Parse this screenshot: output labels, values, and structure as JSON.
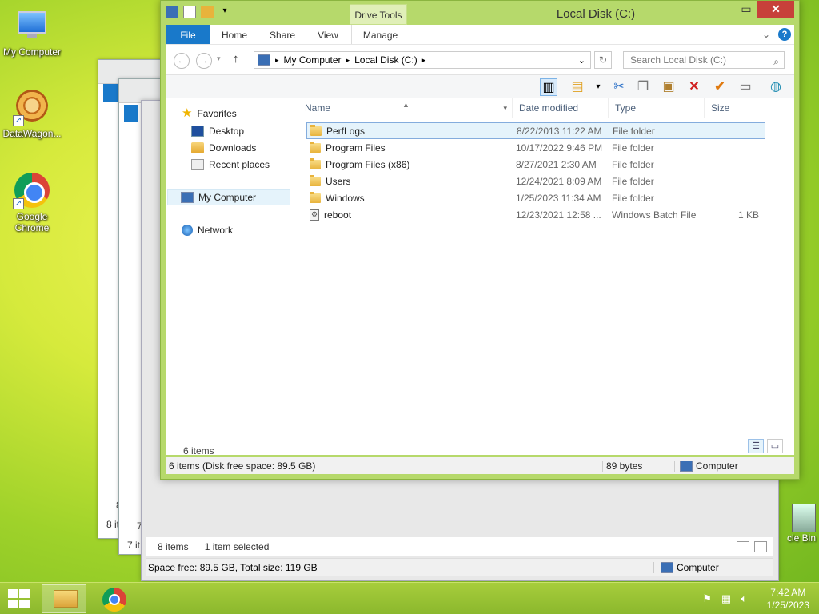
{
  "desktop": {
    "icons": [
      {
        "label": "My Computer"
      },
      {
        "label": "DataWagon..."
      },
      {
        "label": "Google Chrome"
      }
    ],
    "recycle_bin_partial": "cle Bin"
  },
  "back_windows": {
    "win1_status_partial": "8 it",
    "win1_digit": "8",
    "win2_status_partial": "7 it",
    "win2_digit": "7"
  },
  "back_explorer": {
    "items_count": "8 items",
    "selected": "1 item selected",
    "space": "Space free: 89.5 GB, Total size: 119 GB",
    "computer": "Computer"
  },
  "window": {
    "title": "Local Disk (C:)",
    "context_tab": "Drive Tools",
    "tabs": [
      "File",
      "Home",
      "Share",
      "View",
      "Manage"
    ],
    "breadcrumb": [
      "My Computer",
      "Local Disk (C:)"
    ],
    "search_placeholder": "Search Local Disk (C:)",
    "columns": [
      "Name",
      "Date modified",
      "Type",
      "Size"
    ],
    "nav": {
      "favorites": "Favorites",
      "desktop": "Desktop",
      "downloads": "Downloads",
      "recent": "Recent places",
      "my_computer": "My Computer",
      "network": "Network"
    },
    "files": [
      {
        "name": "PerfLogs",
        "date": "8/22/2013 11:22 AM",
        "type": "File folder",
        "size": ""
      },
      {
        "name": "Program Files",
        "date": "10/17/2022 9:46 PM",
        "type": "File folder",
        "size": ""
      },
      {
        "name": "Program Files (x86)",
        "date": "8/27/2021 2:30 AM",
        "type": "File folder",
        "size": ""
      },
      {
        "name": "Users",
        "date": "12/24/2021 8:09 AM",
        "type": "File folder",
        "size": ""
      },
      {
        "name": "Windows",
        "date": "1/25/2023 11:34 AM",
        "type": "File folder",
        "size": ""
      },
      {
        "name": "reboot",
        "date": "12/23/2021 12:58 ...",
        "type": "Windows Batch File",
        "size": "1 KB"
      }
    ],
    "items_count": "6 items",
    "status": {
      "main": "6 items (Disk free space: 89.5 GB)",
      "size": "89 bytes",
      "computer": "Computer"
    }
  },
  "taskbar": {
    "time": "7:42 AM",
    "date": "1/25/2023"
  },
  "colors": {
    "file_tab": "#1979ca",
    "close_button": "#c7403a",
    "window_frame": "#b6d96b",
    "selection": "#e5f3fb"
  }
}
